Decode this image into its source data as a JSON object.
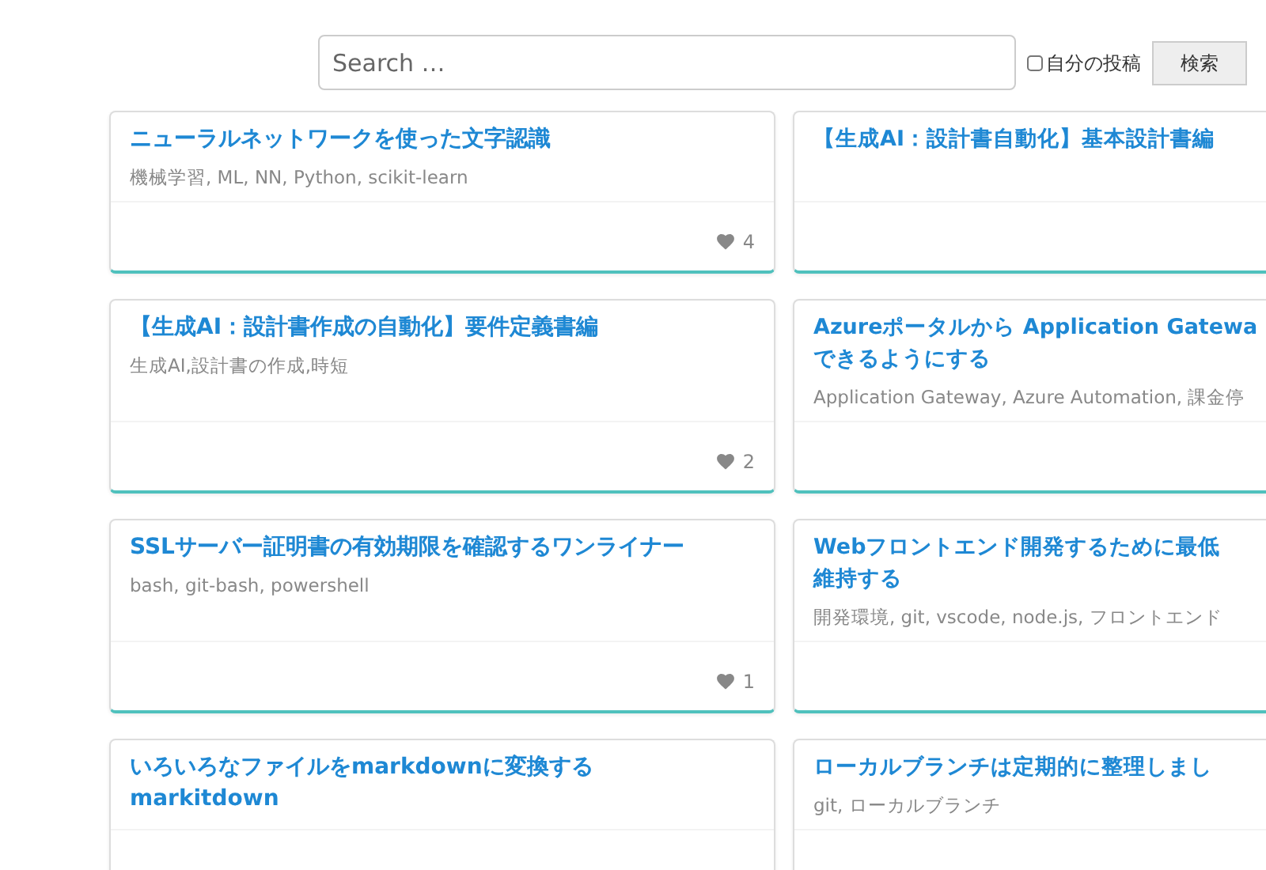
{
  "search": {
    "placeholder": "Search …",
    "own_posts": {
      "label": "自分の投稿",
      "checked": false
    },
    "button": "検索"
  },
  "posts": [
    {
      "title": [
        "ニューラルネットワークを使った文字認識"
      ],
      "tags": "機械学習, ML, NN, Python, scikit-learn",
      "likes": "4"
    },
    {
      "title": [
        "【生成AI：設計書自動化】基本設計書編"
      ]
    },
    {
      "title": [
        "【生成AI：設計書作成の自動化】要件定義書編"
      ],
      "tags": "生成AI,設計書の作成,時短",
      "likes": "2"
    },
    {
      "title": [
        "Azureポータルから Application Gatewa",
        "できるようにする"
      ],
      "tags": "Application Gateway, Azure Automation, 課金停"
    },
    {
      "title": [
        "SSLサーバー証明書の有効期限を確認するワンライナー"
      ],
      "tags": "bash, git-bash, powershell",
      "likes": "1"
    },
    {
      "title": [
        "Webフロントエンド開発するために最低",
        "維持する"
      ],
      "tags": "開発環境, git, vscode, node.js, フロントエンド"
    },
    {
      "title": [
        "いろいろなファイルをmarkdownに変換する",
        "markitdown"
      ]
    },
    {
      "title": [
        "ローカルブランチは定期的に整理しまし"
      ],
      "tags": "git, ローカルブランチ"
    }
  ]
}
